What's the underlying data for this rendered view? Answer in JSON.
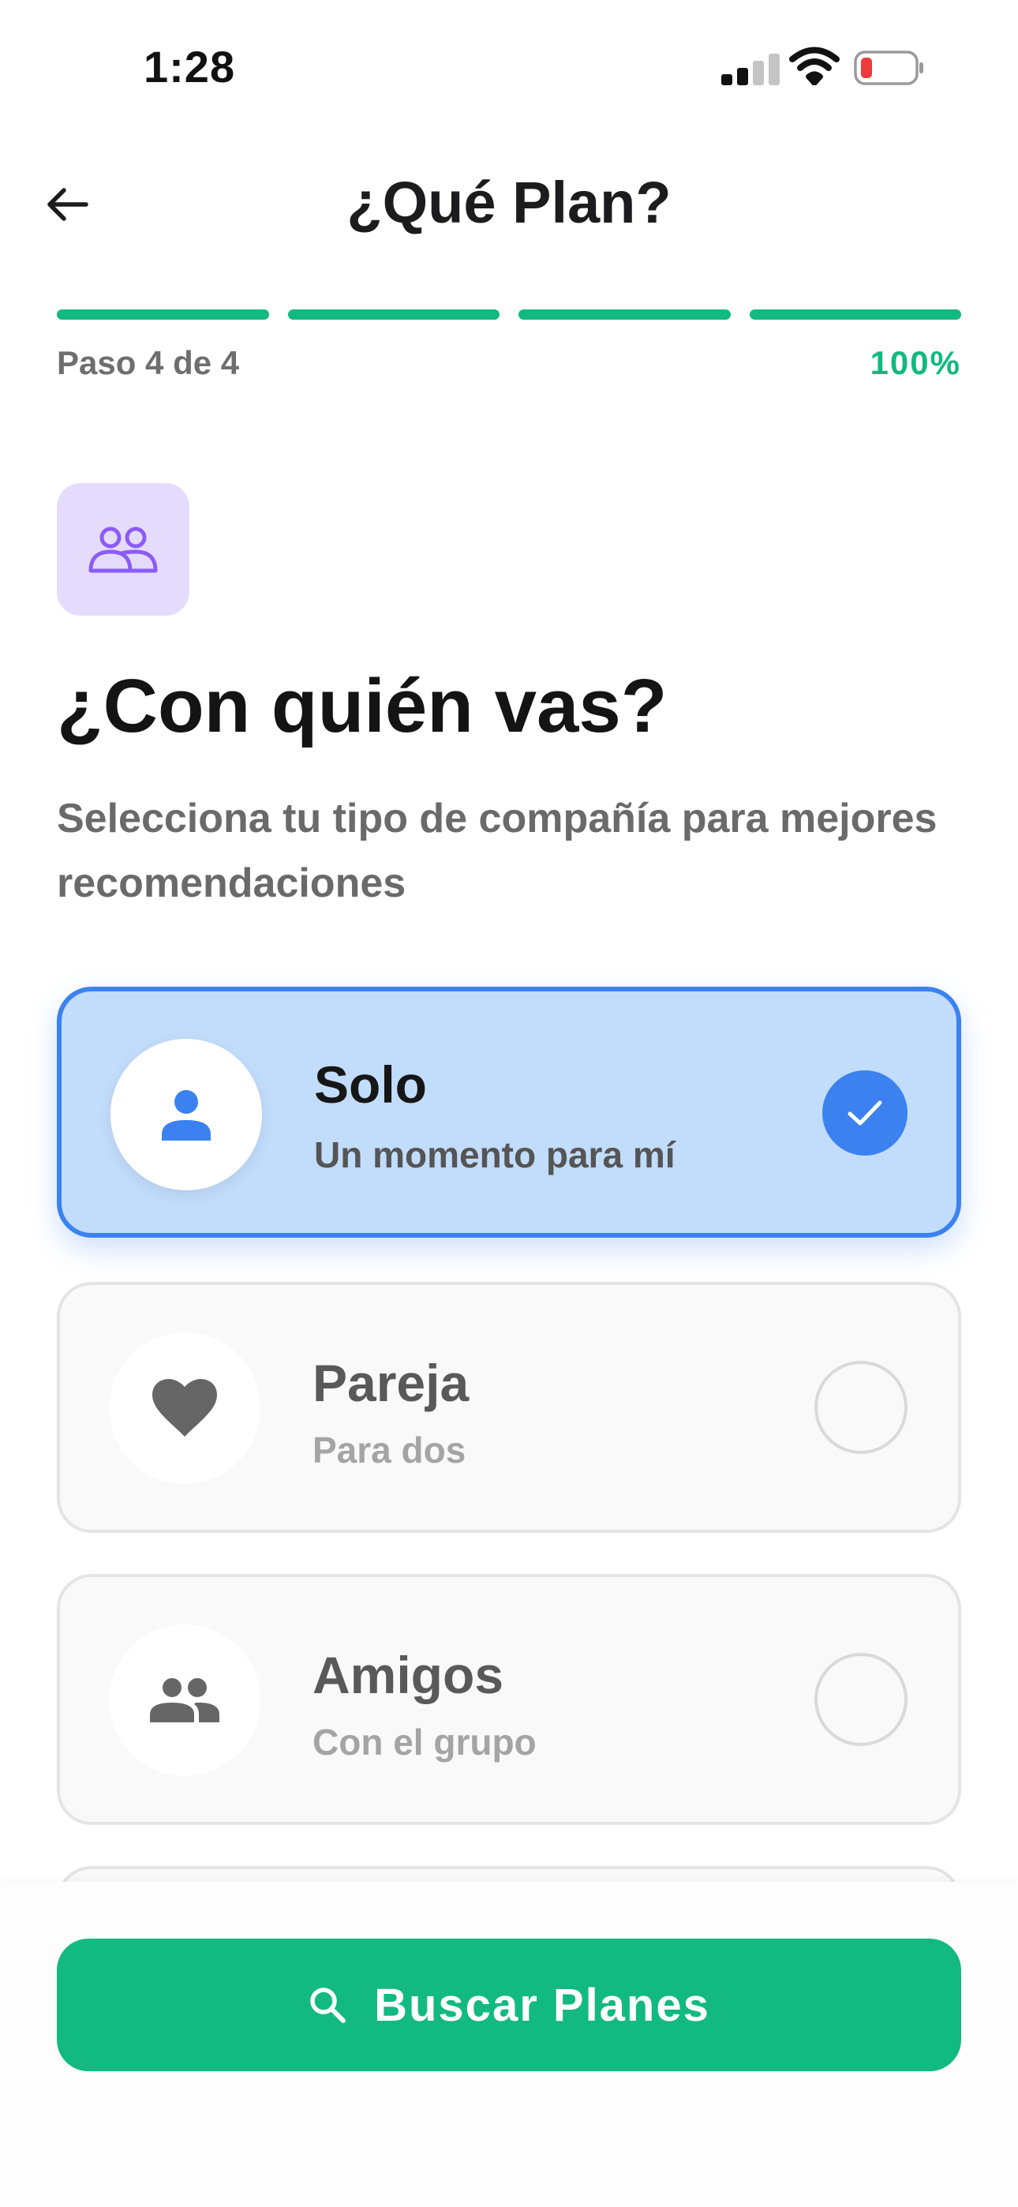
{
  "status_bar": {
    "time": "1:28",
    "icons": [
      "cellular-signal-icon",
      "wifi-icon",
      "battery-low-icon"
    ],
    "battery_color": "#ef3b3b"
  },
  "header": {
    "back_icon": "arrow-left-icon",
    "title": "¿Qué Plan?"
  },
  "progress": {
    "step_label": "Paso 4 de 4",
    "percent_label": "100%",
    "total_steps": 4,
    "completed_steps": 4,
    "fraction": 1.0,
    "color": "#12b981"
  },
  "hero": {
    "icon": "people-outline-icon",
    "icon_bg": "#e5dcfd",
    "icon_color": "#8b5cf6",
    "question": "¿Con quién vas?",
    "subtitle": "Selecciona tu tipo de compañía para mejores recomendaciones"
  },
  "options": [
    {
      "id": "solo",
      "icon": "person-icon",
      "title": "Solo",
      "subtitle": "Un momento para mí",
      "selected": true
    },
    {
      "id": "pareja",
      "icon": "heart-icon",
      "title": "Pareja",
      "subtitle": "Para dos",
      "selected": false
    },
    {
      "id": "amigos",
      "icon": "group-icon",
      "title": "Amigos",
      "subtitle": "Con el grupo",
      "selected": false
    }
  ],
  "cta": {
    "icon": "search-icon",
    "label": "Buscar Planes",
    "color": "#12b981"
  },
  "colors": {
    "accent_green": "#12b981",
    "selected_blue": "#3b82f0",
    "selected_bg": "#c2dcfc"
  }
}
